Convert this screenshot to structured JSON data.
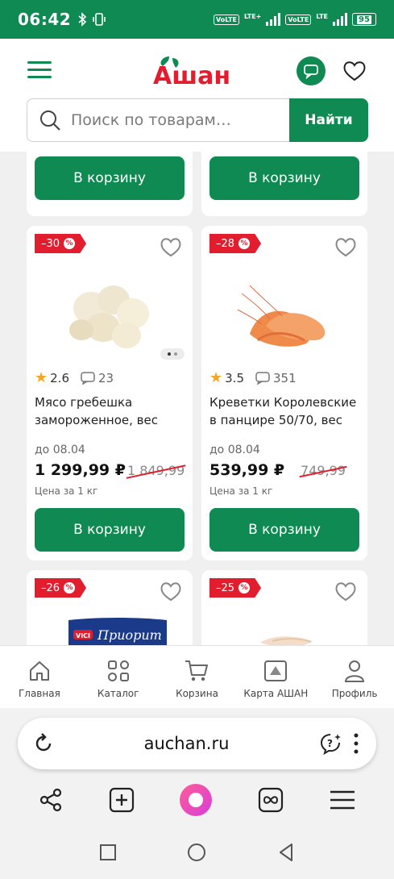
{
  "status_bar": {
    "time": "06:42",
    "volte_1": "VoLTE",
    "lte_1": "LTE+",
    "volte_2": "VoLTE",
    "lte_2": "LTE",
    "battery": "95"
  },
  "header": {
    "logo_text": "Ашан",
    "search_placeholder": "Поиск по товарам…",
    "search_button": "Найти"
  },
  "colors": {
    "brand_green": "#0e8a52",
    "discount_red": "#e11d2e",
    "star": "#f5a623"
  },
  "top_row": {
    "cart_label_left": "В корзину",
    "cart_label_right": "В корзину"
  },
  "products": [
    {
      "discount": "–30",
      "rating": "2.6",
      "reviews": "23",
      "title": "Мясо гребешка замороженное, вес",
      "valid_until": "до 08.04",
      "price": "1 299,99 ₽",
      "old_price": "1 849,99",
      "unit": "Цена за 1 кг",
      "cart_label": "В корзину"
    },
    {
      "discount": "–28",
      "rating": "3.5",
      "reviews": "351",
      "title": "Креветки Королевские в панцире 50/70, вес",
      "valid_until": "до 08.04",
      "price": "539,99 ₽",
      "old_price": "749,99",
      "unit": "Цена за 1 кг",
      "cart_label": "В корзину"
    },
    {
      "discount": "–26",
      "package_brand": "VICI",
      "package_text": "Приорит"
    },
    {
      "discount": "–25"
    }
  ],
  "pct_sign": "%",
  "bottom_nav": [
    {
      "label": "Главная",
      "icon": "home-icon"
    },
    {
      "label": "Каталог",
      "icon": "catalog-icon"
    },
    {
      "label": "Корзина",
      "icon": "cart-icon"
    },
    {
      "label": "Карта АШАН",
      "icon": "loyalty-card-icon"
    },
    {
      "label": "Профиль",
      "icon": "profile-icon"
    }
  ],
  "browser": {
    "url": "auchan.ru"
  }
}
